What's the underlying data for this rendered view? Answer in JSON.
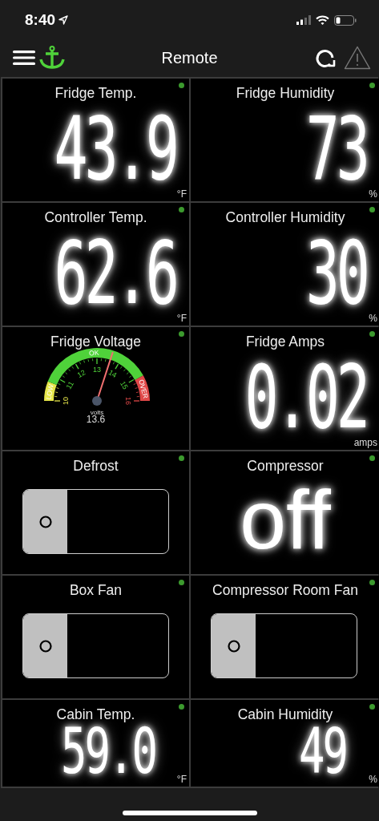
{
  "status_bar": {
    "time": "8:40"
  },
  "nav": {
    "title": "Remote"
  },
  "tiles": [
    {
      "kind": "digital",
      "title": "Fridge Temp.",
      "online": true,
      "value": "43.9",
      "unit": "°F"
    },
    {
      "kind": "digital",
      "title": "Fridge Humidity",
      "online": true,
      "value": "73",
      "unit": "%"
    },
    {
      "kind": "digital",
      "title": "Controller Temp.",
      "online": true,
      "value": "62.6",
      "unit": "°F"
    },
    {
      "kind": "digital",
      "title": "Controller Humidity",
      "online": true,
      "value": "30",
      "unit": "%"
    },
    {
      "kind": "gauge",
      "title": "Fridge Voltage",
      "online": true,
      "unit": "volts",
      "reading": "13.6",
      "scale": [
        "10",
        "11",
        "12",
        "13",
        "14",
        "15",
        "16"
      ],
      "zones": [
        {
          "label": "LOW",
          "color": "#e6e64a"
        },
        {
          "label": "OK",
          "color": "#4fd23a"
        },
        {
          "label": "OVER",
          "color": "#e04848"
        }
      ]
    },
    {
      "kind": "digital",
      "title": "Fridge Amps",
      "online": true,
      "value": "0.02",
      "unit": "amps"
    },
    {
      "kind": "toggle",
      "title": "Defrost",
      "online": true,
      "on": false
    },
    {
      "kind": "state",
      "title": "Compressor",
      "online": true,
      "value": "off"
    },
    {
      "kind": "toggle",
      "title": "Box Fan",
      "online": true,
      "on": false
    },
    {
      "kind": "toggle",
      "title": "Compressor Room Fan",
      "online": true,
      "on": false
    },
    {
      "kind": "compact",
      "title": "Cabin Temp.",
      "online": true,
      "value": "59.0",
      "unit": "°F"
    },
    {
      "kind": "compact",
      "title": "Cabin Humidity",
      "online": true,
      "value": "49",
      "unit": "%"
    }
  ]
}
